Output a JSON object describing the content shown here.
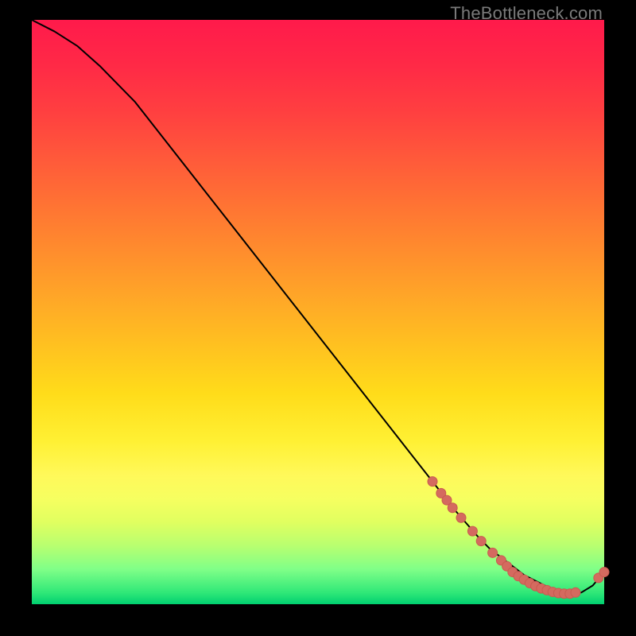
{
  "watermark": "TheBottleneck.com",
  "colors": {
    "curve": "#000000",
    "marker_fill": "#d46a5f",
    "marker_stroke": "#c95a50"
  },
  "chart_data": {
    "type": "line",
    "title": "",
    "xlabel": "",
    "ylabel": "",
    "xlim": [
      0,
      100
    ],
    "ylim": [
      0,
      100
    ],
    "grid": false,
    "legend": false,
    "series": [
      {
        "name": "bottleneck-curve",
        "x": [
          0,
          4,
          8,
          12,
          18,
          26,
          34,
          42,
          50,
          58,
          64,
          70,
          74,
          78,
          80,
          82,
          84,
          86,
          88,
          90,
          92,
          94,
          96,
          98,
          100
        ],
        "y": [
          100,
          98,
          95.5,
          92,
          86,
          76,
          66,
          56,
          46,
          36,
          28.5,
          21,
          16,
          11.5,
          9.5,
          8,
          6.5,
          5,
          4,
          3,
          2.2,
          1.8,
          2,
          3.2,
          5.5
        ]
      }
    ],
    "markers": [
      {
        "x": 70,
        "y": 21
      },
      {
        "x": 71.5,
        "y": 19
      },
      {
        "x": 72.5,
        "y": 17.8
      },
      {
        "x": 73.5,
        "y": 16.5
      },
      {
        "x": 75,
        "y": 14.8
      },
      {
        "x": 77,
        "y": 12.5
      },
      {
        "x": 78.5,
        "y": 10.8
      },
      {
        "x": 80.5,
        "y": 8.8
      },
      {
        "x": 82,
        "y": 7.5
      },
      {
        "x": 83,
        "y": 6.5
      },
      {
        "x": 84,
        "y": 5.5
      },
      {
        "x": 85,
        "y": 4.8
      },
      {
        "x": 86,
        "y": 4.2
      },
      {
        "x": 87,
        "y": 3.6
      },
      {
        "x": 88,
        "y": 3.1
      },
      {
        "x": 89,
        "y": 2.7
      },
      {
        "x": 90,
        "y": 2.4
      },
      {
        "x": 91,
        "y": 2.1
      },
      {
        "x": 92,
        "y": 1.9
      },
      {
        "x": 93,
        "y": 1.8
      },
      {
        "x": 94,
        "y": 1.8
      },
      {
        "x": 95,
        "y": 2.0
      },
      {
        "x": 99,
        "y": 4.5
      },
      {
        "x": 100,
        "y": 5.5
      }
    ]
  }
}
